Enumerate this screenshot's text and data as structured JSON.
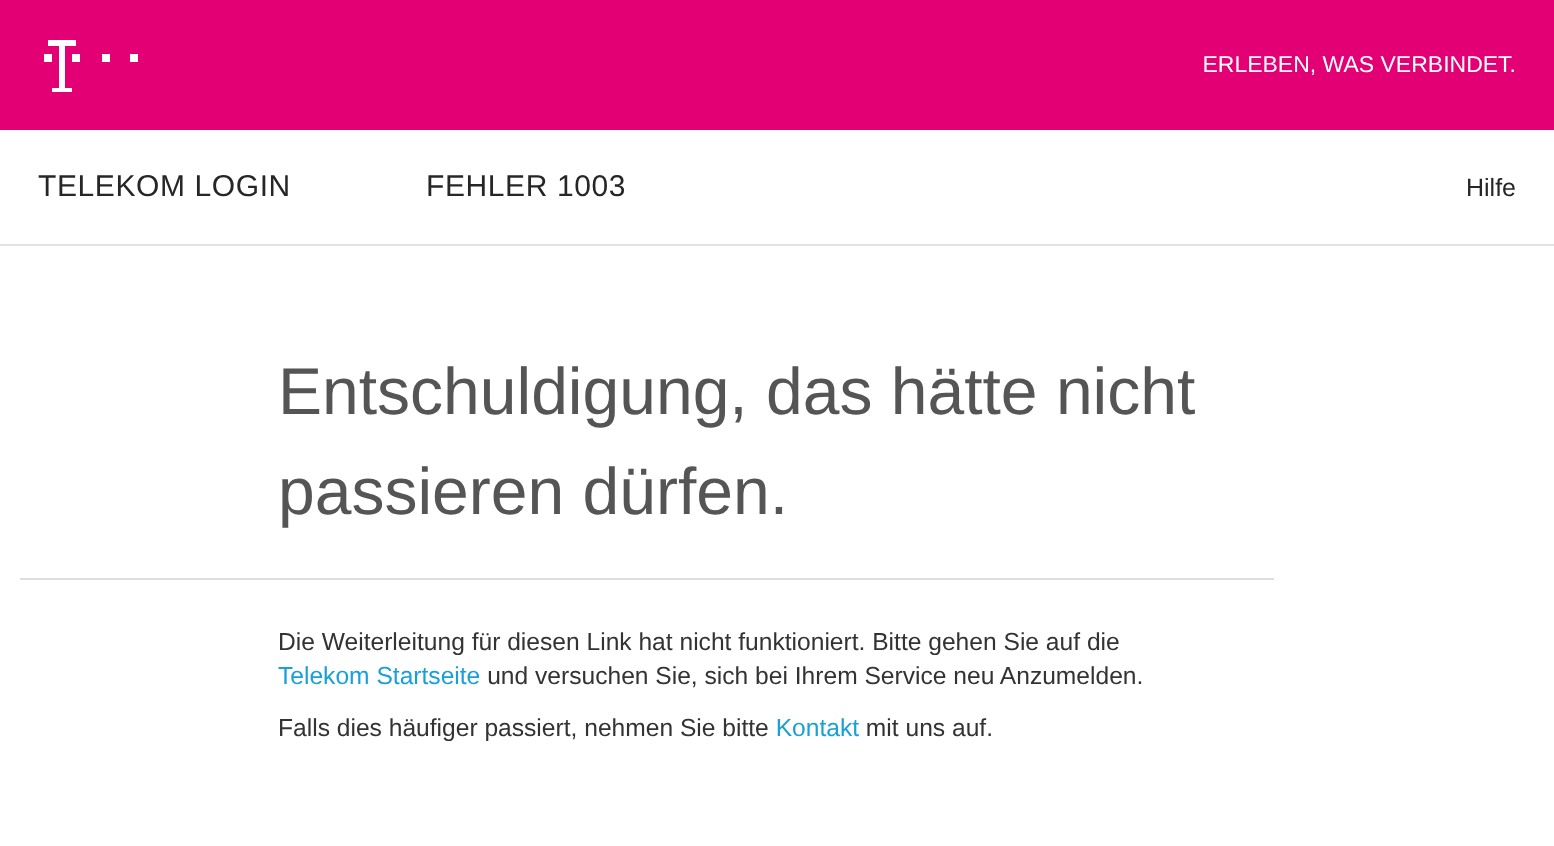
{
  "header": {
    "claim": "ERLEBEN, WAS VERBINDET."
  },
  "nav": {
    "title": "TELEKOM LOGIN",
    "error_code": "FEHLER 1003",
    "help": "Hilfe"
  },
  "heading": "Entschuldigung, das hätte nicht passieren dürfen.",
  "paragraphs": [
    [
      {
        "kind": "text",
        "text": "Die Weiterleitung für diesen Link hat nicht funktioniert. Bitte gehen Sie auf die "
      },
      {
        "kind": "link",
        "text": "Telekom Startseite"
      },
      {
        "kind": "text",
        "text": " und versuchen Sie, sich bei Ihrem Service neu Anzumelden."
      }
    ],
    [
      {
        "kind": "text",
        "text": "Falls dies häufiger passiert, nehmen Sie bitte "
      },
      {
        "kind": "link",
        "text": "Kontakt"
      },
      {
        "kind": "text",
        "text": " mit uns auf."
      }
    ]
  ]
}
